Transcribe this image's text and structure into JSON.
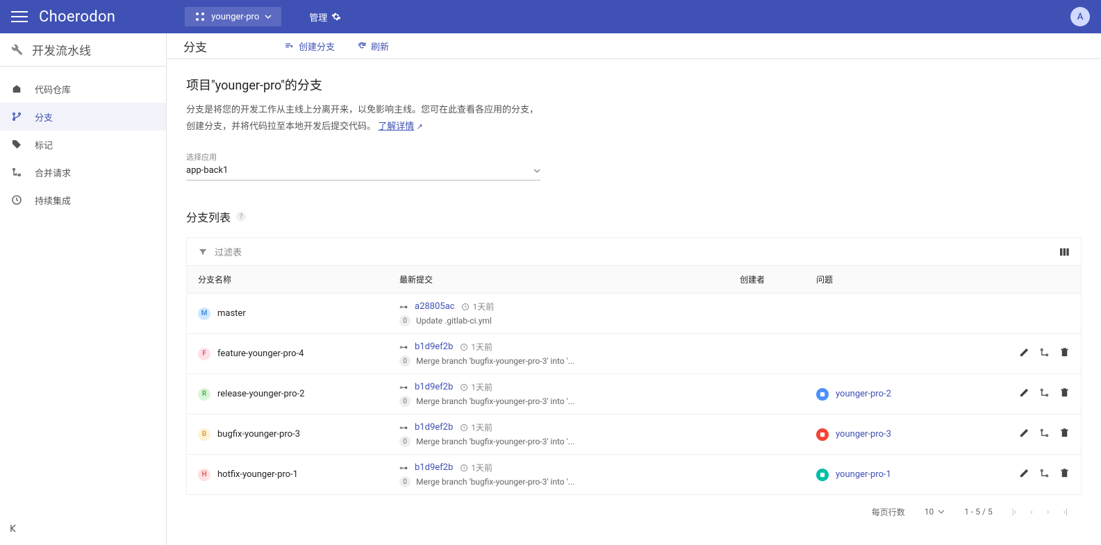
{
  "topbar": {
    "logo": "Choerodon",
    "project": "younger-pro",
    "manage": "管理",
    "avatar": "A"
  },
  "sidebar": {
    "title": "开发流水线",
    "items": [
      {
        "label": "代码仓库"
      },
      {
        "label": "分支"
      },
      {
        "label": "标记"
      },
      {
        "label": "合并请求"
      },
      {
        "label": "持续集成"
      }
    ]
  },
  "toolbar": {
    "title": "分支",
    "create": "创建分支",
    "refresh": "刷新"
  },
  "page": {
    "title": "项目\"younger-pro\"的分支",
    "desc1": "分支是将您的开发工作从主线上分离开来，以免影响主线。您可在此查看各应用的分支，",
    "desc2": "创建分支，并将代码拉至本地开发后提交代码。",
    "learn_more": "了解详情",
    "select_label": "选择应用",
    "select_value": "app-back1",
    "list_title": "分支列表"
  },
  "table": {
    "filter_label": "过滤表",
    "headers": {
      "name": "分支名称",
      "commit": "最新提交",
      "creator": "创建者",
      "issue": "问题"
    },
    "rows": [
      {
        "badge": "M",
        "badge_bg": "#cfe8ff",
        "badge_fg": "#3b8cde",
        "branch": "master",
        "hash": "a28805ac",
        "time": "1天前",
        "msg": "Update .gitlab-ci.yml",
        "issue": null,
        "issue_color": null,
        "actions": false
      },
      {
        "badge": "F",
        "badge_bg": "#ffe0e6",
        "badge_fg": "#e0567a",
        "branch": "feature-younger-pro-4",
        "hash": "b1d9ef2b",
        "time": "1天前",
        "msg": "Merge branch 'bugfix-younger-pro-3' into '...",
        "issue": null,
        "issue_color": null,
        "actions": true
      },
      {
        "badge": "R",
        "badge_bg": "#d9f5d9",
        "badge_fg": "#4caf50",
        "branch": "release-younger-pro-2",
        "hash": "b1d9ef2b",
        "time": "1天前",
        "msg": "Merge branch 'bugfix-younger-pro-3' into '...",
        "issue": "younger-pro-2",
        "issue_color": "#4d90fe",
        "actions": true
      },
      {
        "badge": "B",
        "badge_bg": "#fff3d6",
        "badge_fg": "#d9a030",
        "branch": "bugfix-younger-pro-3",
        "hash": "b1d9ef2b",
        "time": "1天前",
        "msg": "Merge branch 'bugfix-younger-pro-3' into '...",
        "issue": "younger-pro-3",
        "issue_color": "#f44336",
        "actions": true
      },
      {
        "badge": "H",
        "badge_bg": "#ffe0e0",
        "badge_fg": "#e05555",
        "branch": "hotfix-younger-pro-1",
        "hash": "b1d9ef2b",
        "time": "1天前",
        "msg": "Merge branch 'bugfix-younger-pro-3' into '...",
        "issue": "younger-pro-1",
        "issue_color": "#00bfa5",
        "actions": true
      }
    ]
  },
  "pagination": {
    "per_page_label": "每页行数",
    "per_page": "10",
    "range": "1 - 5 / 5"
  }
}
